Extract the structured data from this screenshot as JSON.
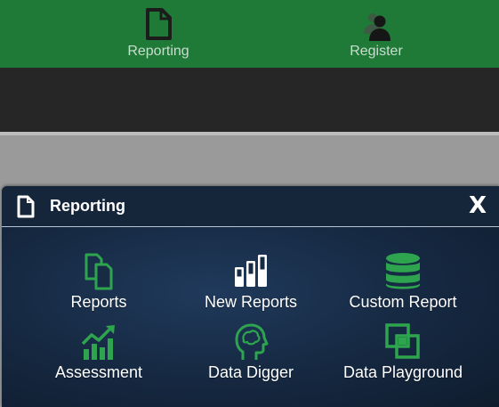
{
  "topnav": {
    "items": [
      {
        "label": "Reporting",
        "icon": "document-icon"
      },
      {
        "label": "Register",
        "icon": "users-icon"
      }
    ]
  },
  "panel": {
    "title": "Reporting",
    "title_icon": "document-icon",
    "close_label": "X",
    "tiles": [
      {
        "label": "Reports",
        "icon": "copy-documents-icon"
      },
      {
        "label": "New Reports",
        "icon": "bar-levels-icon"
      },
      {
        "label": "Custom Report",
        "icon": "database-icon"
      },
      {
        "label": "Assessment",
        "icon": "growth-chart-icon"
      },
      {
        "label": "Data Digger",
        "icon": "head-brain-icon"
      },
      {
        "label": "Data Playground",
        "icon": "overlap-squares-icon"
      }
    ]
  },
  "colors": {
    "topbar": "#1f7a37",
    "darkbar": "#262626",
    "accent_green": "#2ea44f",
    "panel_bg": "#172b45"
  }
}
